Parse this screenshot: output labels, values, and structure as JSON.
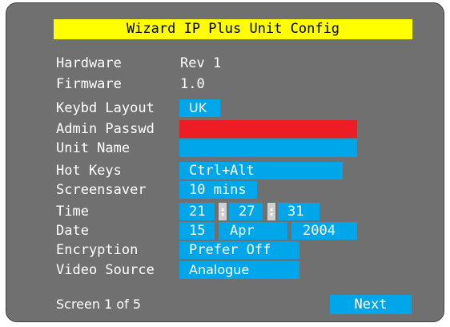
{
  "title": "Wizard IP Plus Unit Config",
  "fields": {
    "hardware": {
      "label": "Hardware",
      "value": "Rev 1"
    },
    "firmware": {
      "label": "Firmware",
      "value": "1.0"
    },
    "keyboard_layout": {
      "label": "Keybd Layout",
      "value": "UK"
    },
    "admin_password": {
      "label": "Admin Passwd",
      "value": ""
    },
    "unit_name": {
      "label": "Unit Name",
      "value": ""
    },
    "hot_keys": {
      "label": "Hot Keys",
      "value": "Ctrl+Alt"
    },
    "screensaver": {
      "label": "Screensaver",
      "value": "10 mins"
    },
    "time": {
      "label": "Time",
      "hours": "21",
      "minutes": "27",
      "seconds": "31",
      "separator": ":"
    },
    "date": {
      "label": "Date",
      "day": "15",
      "month": "Apr",
      "year": "2004"
    },
    "encryption": {
      "label": "Encryption",
      "value": "Prefer Off"
    },
    "video_source": {
      "label": "Video Source",
      "value": "Analogue"
    }
  },
  "footer": {
    "screen_indicator": "Screen 1 of 5",
    "next_label": "Next"
  },
  "colors": {
    "panel_background": "#707070",
    "title_background": "#ffff00",
    "field_background": "#00a6ea",
    "password_field_background": "#ee1c25",
    "text": "#ffffff"
  }
}
